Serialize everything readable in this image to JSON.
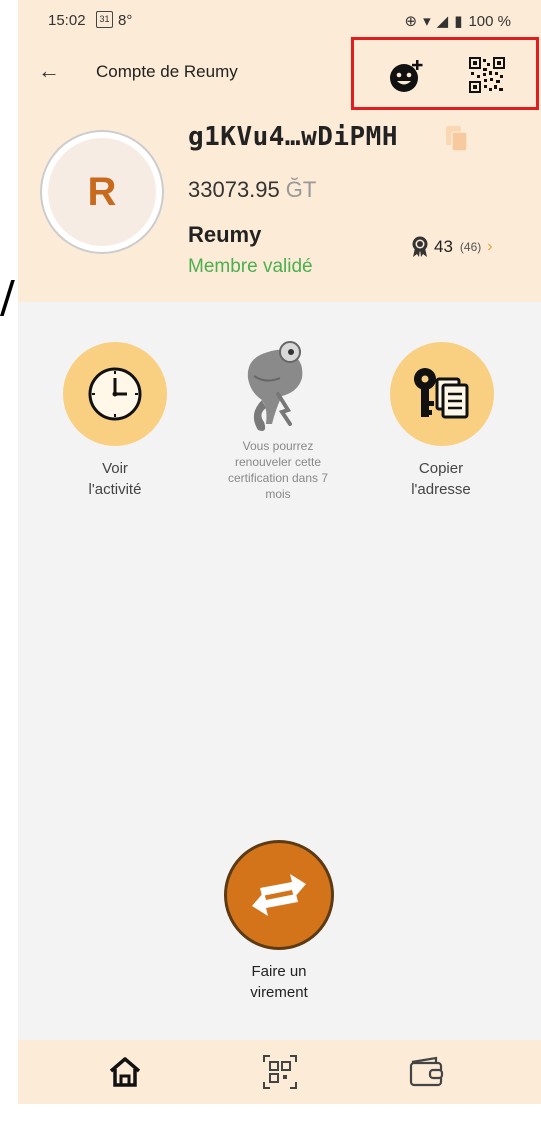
{
  "status": {
    "time": "15:02",
    "calendar_day": "31",
    "temperature": "8°",
    "battery": "100 %"
  },
  "header": {
    "title": "Compte de Reumy",
    "pubkey": "g1KVu4…wDiPMH",
    "balance": "33073.95",
    "unit": "ĞT",
    "avatar_letter": "R",
    "username": "Reumy",
    "member_status": "Membre validé",
    "cert_count": "43",
    "cert_total": "(46)"
  },
  "actions": {
    "activity_label": "Voir\nl'activité",
    "renew_text": "Vous pourrez renouveler cette certification dans 7 mois",
    "copy_address_label": "Copier\nl'adresse",
    "transfer_label": "Faire un\nvirement"
  },
  "icons": {
    "back": "arrow-left-icon",
    "add_contact": "add-contact-icon",
    "qr": "qr-code-icon",
    "copy": "copy-icon",
    "cert": "certification-badge-icon",
    "clock": "clock-icon",
    "key_doc": "key-document-icon",
    "chameleon": "chameleon-illustration",
    "transfer": "transfer-arrows-icon",
    "home": "home-icon",
    "scan": "qr-scan-icon",
    "wallet": "wallet-icon"
  },
  "colors": {
    "header_bg": "#fcebd6",
    "accent": "#d4741a",
    "action_bg": "#f9cf82",
    "valid_green": "#4caf50",
    "highlight": "#e11d1d"
  }
}
